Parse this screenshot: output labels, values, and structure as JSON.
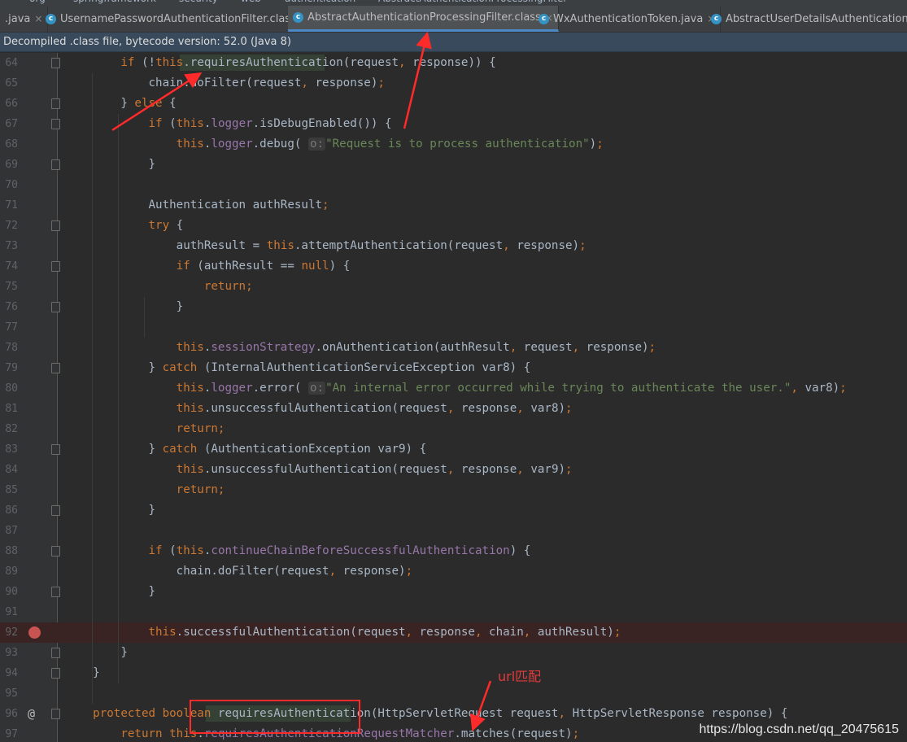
{
  "breadcrumb": [
    "org",
    "springframework",
    "security",
    "web",
    "authentication",
    "AbstractAuthenticationProcessingFilter"
  ],
  "tabs": [
    {
      "label": ".java",
      "active": false,
      "icon": "none"
    },
    {
      "label": "UsernamePasswordAuthenticationFilter.class",
      "active": false,
      "icon": "class-icon"
    },
    {
      "label": "AbstractAuthenticationProcessingFilter.class",
      "active": true,
      "icon": "class-icon"
    },
    {
      "label": "WxAuthenticationToken.java",
      "active": false,
      "icon": "class-icon"
    },
    {
      "label": "AbstractUserDetailsAuthenticationProv",
      "active": false,
      "icon": "class-icon"
    }
  ],
  "tab_close_glyph": "×",
  "info_bar": "Decompiled .class file, bytecode version: 52.0 (Java 8)",
  "hint_label": "o:",
  "code_lines": [
    {
      "num": "64",
      "text": "        if (!this.requiresAuthentication(request, response)) {"
    },
    {
      "num": "65",
      "text": "            chain.doFilter(request, response);"
    },
    {
      "num": "66",
      "text": "        } else {"
    },
    {
      "num": "67",
      "text": "            if (this.logger.isDebugEnabled()) {"
    },
    {
      "num": "68",
      "text": "                this.logger.debug( o:\"Request is to process authentication\");"
    },
    {
      "num": "69",
      "text": "            }"
    },
    {
      "num": "70",
      "text": ""
    },
    {
      "num": "71",
      "text": "            Authentication authResult;"
    },
    {
      "num": "72",
      "text": "            try {"
    },
    {
      "num": "73",
      "text": "                authResult = this.attemptAuthentication(request, response);"
    },
    {
      "num": "74",
      "text": "                if (authResult == null) {"
    },
    {
      "num": "75",
      "text": "                    return;"
    },
    {
      "num": "76",
      "text": "                }"
    },
    {
      "num": "77",
      "text": ""
    },
    {
      "num": "78",
      "text": "                this.sessionStrategy.onAuthentication(authResult, request, response);"
    },
    {
      "num": "79",
      "text": "            } catch (InternalAuthenticationServiceException var8) {"
    },
    {
      "num": "80",
      "text": "                this.logger.error( o:\"An internal error occurred while trying to authenticate the user.\", var8);"
    },
    {
      "num": "81",
      "text": "                this.unsuccessfulAuthentication(request, response, var8);"
    },
    {
      "num": "82",
      "text": "                return;"
    },
    {
      "num": "83",
      "text": "            } catch (AuthenticationException var9) {"
    },
    {
      "num": "84",
      "text": "                this.unsuccessfulAuthentication(request, response, var9);"
    },
    {
      "num": "85",
      "text": "                return;"
    },
    {
      "num": "86",
      "text": "            }"
    },
    {
      "num": "87",
      "text": ""
    },
    {
      "num": "88",
      "text": "            if (this.continueChainBeforeSuccessfulAuthentication) {"
    },
    {
      "num": "89",
      "text": "                chain.doFilter(request, response);"
    },
    {
      "num": "90",
      "text": "            }"
    },
    {
      "num": "91",
      "text": ""
    },
    {
      "num": "92",
      "text": "            this.successfulAuthentication(request, response, chain, authResult);"
    },
    {
      "num": "93",
      "text": "        }"
    },
    {
      "num": "94",
      "text": "    }"
    },
    {
      "num": "95",
      "text": ""
    },
    {
      "num": "96",
      "text": "    protected boolean requiresAuthentication(HttpServletRequest request, HttpServletResponse response) {"
    },
    {
      "num": "97",
      "text": "        return this.requiresAuthenticationRequestMatcher.matches(request);"
    }
  ],
  "gutter_markers": {
    "92": "breakpoint",
    "96": "override-marker"
  },
  "override_glyph": "@",
  "annotation_text": "url匹配",
  "watermark": "https://blog.csdn.net/qq_20475615",
  "colors": {
    "keyword": "#cc7832",
    "string": "#6a8759",
    "field": "#9876aa",
    "method": "#ffc66d",
    "plain": "#a9b7c6",
    "annotation": "#e23b3b"
  }
}
